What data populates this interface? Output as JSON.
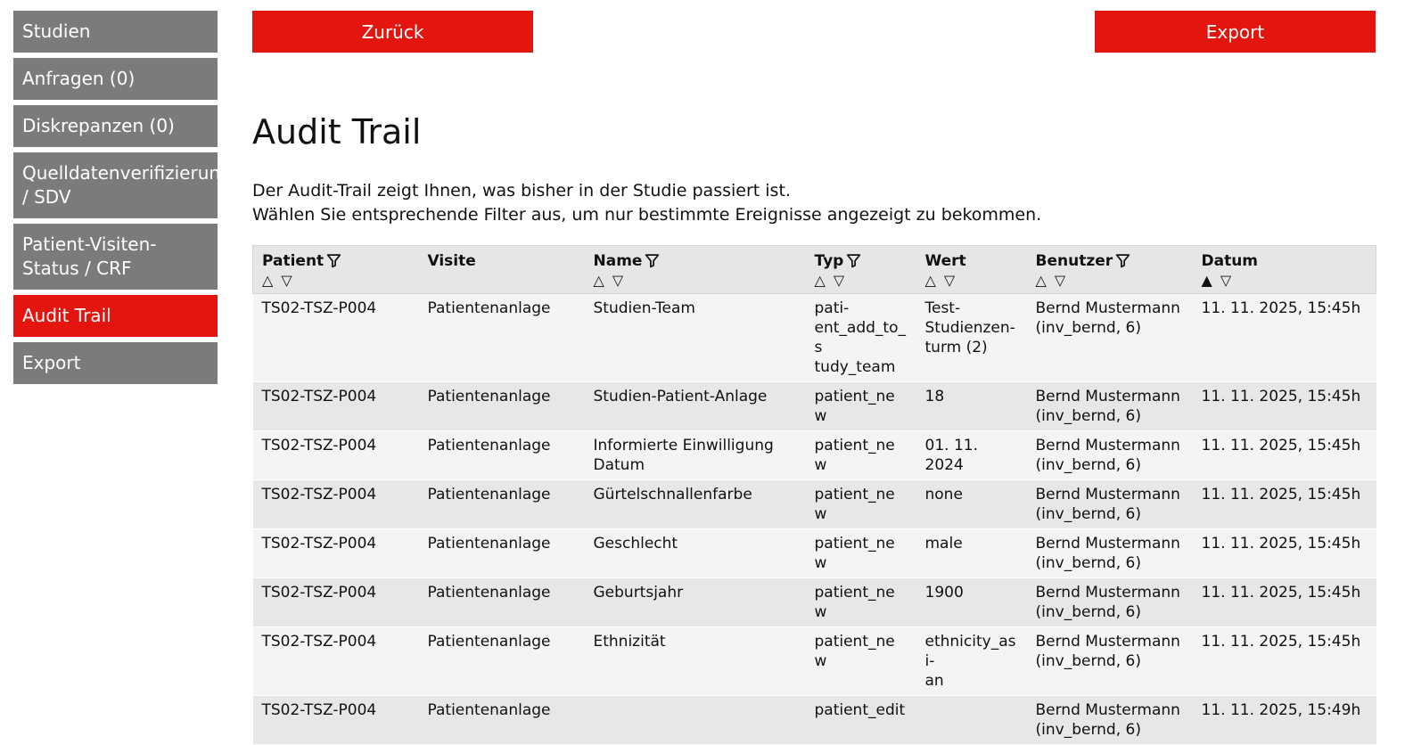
{
  "sidebar": {
    "items": [
      {
        "label": "Studien",
        "active": false
      },
      {
        "label": "Anfragen (0)",
        "active": false
      },
      {
        "label": "Diskrepanzen (0)",
        "active": false
      },
      {
        "label": "Quelldatenverifizierung\n/ SDV",
        "active": false
      },
      {
        "label": "Patient-Visiten-\nStatus / CRF",
        "active": false
      },
      {
        "label": "Audit Trail",
        "active": true
      },
      {
        "label": "Export",
        "active": false
      }
    ]
  },
  "toolbar": {
    "back_label": "Zurück",
    "export_label": "Export"
  },
  "page": {
    "title": "Audit Trail",
    "intro_line1": "Der Audit-Trail zeigt Ihnen, was bisher in der Studie passiert ist.",
    "intro_line2": "Wählen Sie entsprechende Filter aus, um nur bestimmte Ereignisse angezeigt zu bekommen."
  },
  "table": {
    "columns": [
      {
        "label": "Patient",
        "filter": true,
        "sort": "△ ▽"
      },
      {
        "label": "Visite",
        "filter": false,
        "sort": ""
      },
      {
        "label": "Name",
        "filter": true,
        "sort": "△ ▽"
      },
      {
        "label": "Typ",
        "filter": true,
        "sort": "△ ▽"
      },
      {
        "label": "Wert",
        "filter": false,
        "sort": "△ ▽"
      },
      {
        "label": "Benutzer",
        "filter": true,
        "sort": "△ ▽"
      },
      {
        "label": "Datum",
        "filter": false,
        "sort": "▲ ▽"
      }
    ],
    "rows": [
      {
        "patient": "TS02-TSZ-P004",
        "visite": "Patientenanlage",
        "name": "Studien-Team",
        "typ": "pati-\nent_add_to_s\ntudy_team",
        "wert": "Test-\nStudienzen-\nturm (2)",
        "benutzer": "Bernd Mustermann\n(inv_bernd, 6)",
        "datum": "11. 11. 2025, 15:45h"
      },
      {
        "patient": "TS02-TSZ-P004",
        "visite": "Patientenanlage",
        "name": "Studien-Patient-Anlage",
        "typ": "patient_new",
        "wert": "18",
        "benutzer": "Bernd Mustermann\n(inv_bernd, 6)",
        "datum": "11. 11. 2025, 15:45h"
      },
      {
        "patient": "TS02-TSZ-P004",
        "visite": "Patientenanlage",
        "name": "Informierte Einwilligung Datum",
        "typ": "patient_new",
        "wert": "01. 11. 2024",
        "benutzer": "Bernd Mustermann\n(inv_bernd, 6)",
        "datum": "11. 11. 2025, 15:45h"
      },
      {
        "patient": "TS02-TSZ-P004",
        "visite": "Patientenanlage",
        "name": "Gürtelschnallenfarbe",
        "typ": "patient_new",
        "wert": "none",
        "benutzer": "Bernd Mustermann\n(inv_bernd, 6)",
        "datum": "11. 11. 2025, 15:45h"
      },
      {
        "patient": "TS02-TSZ-P004",
        "visite": "Patientenanlage",
        "name": "Geschlecht",
        "typ": "patient_new",
        "wert": "male",
        "benutzer": "Bernd Mustermann\n(inv_bernd, 6)",
        "datum": "11. 11. 2025, 15:45h"
      },
      {
        "patient": "TS02-TSZ-P004",
        "visite": "Patientenanlage",
        "name": "Geburtsjahr",
        "typ": "patient_new",
        "wert": "1900",
        "benutzer": "Bernd Mustermann\n(inv_bernd, 6)",
        "datum": "11. 11. 2025, 15:45h"
      },
      {
        "patient": "TS02-TSZ-P004",
        "visite": "Patientenanlage",
        "name": "Ethnizität",
        "typ": "patient_new",
        "wert": "ethnicity_asi-\nan",
        "benutzer": "Bernd Mustermann\n(inv_bernd, 6)",
        "datum": "11. 11. 2025, 15:45h"
      },
      {
        "patient": "TS02-TSZ-P004",
        "visite": "Patientenanlage",
        "name": "",
        "typ": "patient_edit",
        "wert": "",
        "benutzer": "Bernd Mustermann\n(inv_bernd, 6)",
        "datum": "11. 11. 2025, 15:49h"
      }
    ]
  },
  "colors": {
    "accent": "#e3150e",
    "nav_bg": "#7b7b7b",
    "header_bg": "#e6e6e6",
    "row_odd": "#f4f4f4",
    "row_even": "#e7e7e7"
  },
  "icons": {
    "filter": "filter-funnel-icon"
  }
}
